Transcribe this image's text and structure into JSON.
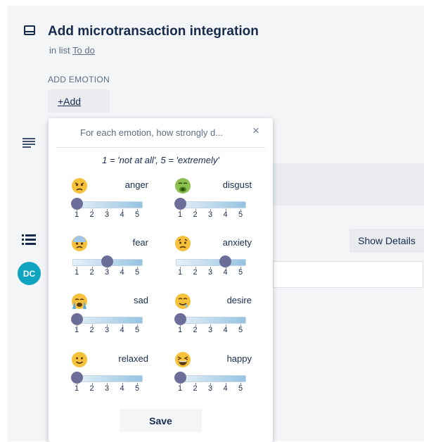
{
  "card": {
    "title": "Add microtransaction integration",
    "list_prefix": "in list",
    "list_name": "To do",
    "add_emotion_label": "ADD EMOTION",
    "add_button": "+Add",
    "show_details": "Show Details",
    "avatar_initials": "DC"
  },
  "popover": {
    "title": "For each emotion, how strongly d...",
    "close": "×",
    "scale_note": "1 = 'not at all', 5 = 'extremely'",
    "save": "Save",
    "ticks": [
      "1",
      "2",
      "3",
      "4",
      "5"
    ],
    "emotions": [
      {
        "name": "anger",
        "value": 1,
        "icon": "angry-face-icon"
      },
      {
        "name": "disgust",
        "value": 1,
        "icon": "nauseated-face-icon"
      },
      {
        "name": "fear",
        "value": 3,
        "icon": "fearful-face-icon"
      },
      {
        "name": "anxiety",
        "value": 4,
        "icon": "worried-face-icon"
      },
      {
        "name": "sad",
        "value": 1,
        "icon": "crying-face-icon"
      },
      {
        "name": "desire",
        "value": 1,
        "icon": "drooling-face-icon"
      },
      {
        "name": "relaxed",
        "value": 1,
        "icon": "slightly-smiling-face-icon"
      },
      {
        "name": "happy",
        "value": 1,
        "icon": "grinning-squinting-face-icon"
      }
    ]
  }
}
